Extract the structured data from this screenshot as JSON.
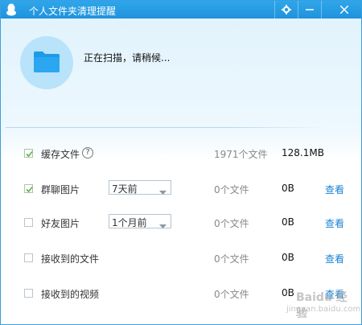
{
  "window": {
    "title": "个人文件夹清理提醒",
    "title_icon": "qq-penguin-icon",
    "controls": [
      "settings-icon",
      "minimize-icon",
      "close-icon"
    ]
  },
  "scan": {
    "icon": "folder-icon",
    "status": "正在扫描，请稍候..."
  },
  "rows": [
    {
      "label": "缓存文件",
      "checked": true,
      "has_help": true,
      "help_glyph": "?",
      "time_filter": null,
      "count": "1971个文件",
      "size": "128.1MB",
      "view": null
    },
    {
      "label": "群聊图片",
      "checked": true,
      "has_help": false,
      "time_filter": "7天前",
      "count": "0个文件",
      "size": "0B",
      "view": "查看"
    },
    {
      "label": "好友图片",
      "checked": false,
      "has_help": false,
      "time_filter": "1个月前",
      "count": "0个文件",
      "size": "0B",
      "view": "查看"
    },
    {
      "label": "接收到的文件",
      "checked": false,
      "has_help": false,
      "time_filter": null,
      "count": "0个文件",
      "size": "0B",
      "view": "查看"
    },
    {
      "label": "接收到的视频",
      "checked": false,
      "has_help": false,
      "time_filter": null,
      "count": "0个文件",
      "size": "0B",
      "view": "查看"
    }
  ],
  "watermark": {
    "text": "Baidu 经验",
    "sub": "jingyan.baidu.com"
  },
  "colors": {
    "titlebar": "#1f93dd",
    "link": "#1b84d0",
    "folder": "#1e9be8",
    "check": "#5ab04a"
  }
}
